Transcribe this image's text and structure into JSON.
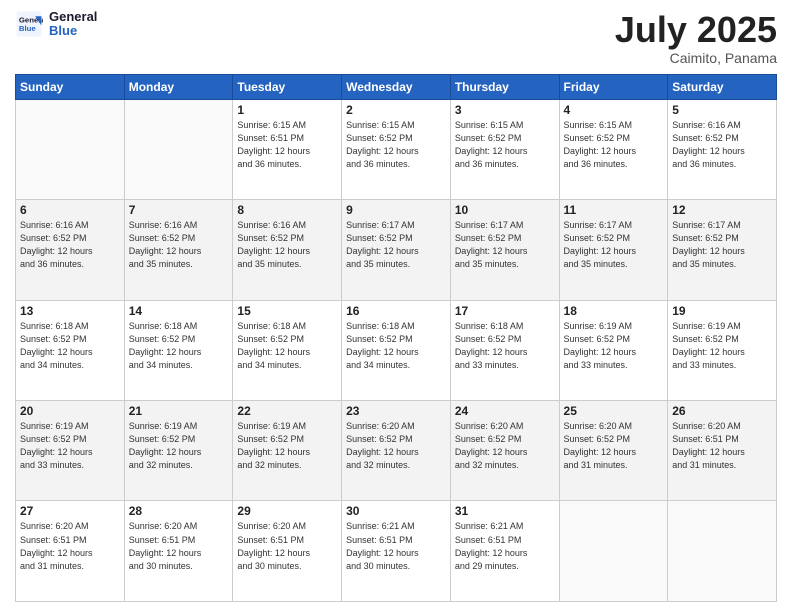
{
  "header": {
    "logo_line1": "General",
    "logo_line2": "Blue",
    "month": "July 2025",
    "location": "Caimito, Panama"
  },
  "weekdays": [
    "Sunday",
    "Monday",
    "Tuesday",
    "Wednesday",
    "Thursday",
    "Friday",
    "Saturday"
  ],
  "weeks": [
    [
      {
        "day": "",
        "info": ""
      },
      {
        "day": "",
        "info": ""
      },
      {
        "day": "1",
        "info": "Sunrise: 6:15 AM\nSunset: 6:51 PM\nDaylight: 12 hours\nand 36 minutes."
      },
      {
        "day": "2",
        "info": "Sunrise: 6:15 AM\nSunset: 6:52 PM\nDaylight: 12 hours\nand 36 minutes."
      },
      {
        "day": "3",
        "info": "Sunrise: 6:15 AM\nSunset: 6:52 PM\nDaylight: 12 hours\nand 36 minutes."
      },
      {
        "day": "4",
        "info": "Sunrise: 6:15 AM\nSunset: 6:52 PM\nDaylight: 12 hours\nand 36 minutes."
      },
      {
        "day": "5",
        "info": "Sunrise: 6:16 AM\nSunset: 6:52 PM\nDaylight: 12 hours\nand 36 minutes."
      }
    ],
    [
      {
        "day": "6",
        "info": "Sunrise: 6:16 AM\nSunset: 6:52 PM\nDaylight: 12 hours\nand 36 minutes."
      },
      {
        "day": "7",
        "info": "Sunrise: 6:16 AM\nSunset: 6:52 PM\nDaylight: 12 hours\nand 35 minutes."
      },
      {
        "day": "8",
        "info": "Sunrise: 6:16 AM\nSunset: 6:52 PM\nDaylight: 12 hours\nand 35 minutes."
      },
      {
        "day": "9",
        "info": "Sunrise: 6:17 AM\nSunset: 6:52 PM\nDaylight: 12 hours\nand 35 minutes."
      },
      {
        "day": "10",
        "info": "Sunrise: 6:17 AM\nSunset: 6:52 PM\nDaylight: 12 hours\nand 35 minutes."
      },
      {
        "day": "11",
        "info": "Sunrise: 6:17 AM\nSunset: 6:52 PM\nDaylight: 12 hours\nand 35 minutes."
      },
      {
        "day": "12",
        "info": "Sunrise: 6:17 AM\nSunset: 6:52 PM\nDaylight: 12 hours\nand 35 minutes."
      }
    ],
    [
      {
        "day": "13",
        "info": "Sunrise: 6:18 AM\nSunset: 6:52 PM\nDaylight: 12 hours\nand 34 minutes."
      },
      {
        "day": "14",
        "info": "Sunrise: 6:18 AM\nSunset: 6:52 PM\nDaylight: 12 hours\nand 34 minutes."
      },
      {
        "day": "15",
        "info": "Sunrise: 6:18 AM\nSunset: 6:52 PM\nDaylight: 12 hours\nand 34 minutes."
      },
      {
        "day": "16",
        "info": "Sunrise: 6:18 AM\nSunset: 6:52 PM\nDaylight: 12 hours\nand 34 minutes."
      },
      {
        "day": "17",
        "info": "Sunrise: 6:18 AM\nSunset: 6:52 PM\nDaylight: 12 hours\nand 33 minutes."
      },
      {
        "day": "18",
        "info": "Sunrise: 6:19 AM\nSunset: 6:52 PM\nDaylight: 12 hours\nand 33 minutes."
      },
      {
        "day": "19",
        "info": "Sunrise: 6:19 AM\nSunset: 6:52 PM\nDaylight: 12 hours\nand 33 minutes."
      }
    ],
    [
      {
        "day": "20",
        "info": "Sunrise: 6:19 AM\nSunset: 6:52 PM\nDaylight: 12 hours\nand 33 minutes."
      },
      {
        "day": "21",
        "info": "Sunrise: 6:19 AM\nSunset: 6:52 PM\nDaylight: 12 hours\nand 32 minutes."
      },
      {
        "day": "22",
        "info": "Sunrise: 6:19 AM\nSunset: 6:52 PM\nDaylight: 12 hours\nand 32 minutes."
      },
      {
        "day": "23",
        "info": "Sunrise: 6:20 AM\nSunset: 6:52 PM\nDaylight: 12 hours\nand 32 minutes."
      },
      {
        "day": "24",
        "info": "Sunrise: 6:20 AM\nSunset: 6:52 PM\nDaylight: 12 hours\nand 32 minutes."
      },
      {
        "day": "25",
        "info": "Sunrise: 6:20 AM\nSunset: 6:52 PM\nDaylight: 12 hours\nand 31 minutes."
      },
      {
        "day": "26",
        "info": "Sunrise: 6:20 AM\nSunset: 6:51 PM\nDaylight: 12 hours\nand 31 minutes."
      }
    ],
    [
      {
        "day": "27",
        "info": "Sunrise: 6:20 AM\nSunset: 6:51 PM\nDaylight: 12 hours\nand 31 minutes."
      },
      {
        "day": "28",
        "info": "Sunrise: 6:20 AM\nSunset: 6:51 PM\nDaylight: 12 hours\nand 30 minutes."
      },
      {
        "day": "29",
        "info": "Sunrise: 6:20 AM\nSunset: 6:51 PM\nDaylight: 12 hours\nand 30 minutes."
      },
      {
        "day": "30",
        "info": "Sunrise: 6:21 AM\nSunset: 6:51 PM\nDaylight: 12 hours\nand 30 minutes."
      },
      {
        "day": "31",
        "info": "Sunrise: 6:21 AM\nSunset: 6:51 PM\nDaylight: 12 hours\nand 29 minutes."
      },
      {
        "day": "",
        "info": ""
      },
      {
        "day": "",
        "info": ""
      }
    ]
  ]
}
